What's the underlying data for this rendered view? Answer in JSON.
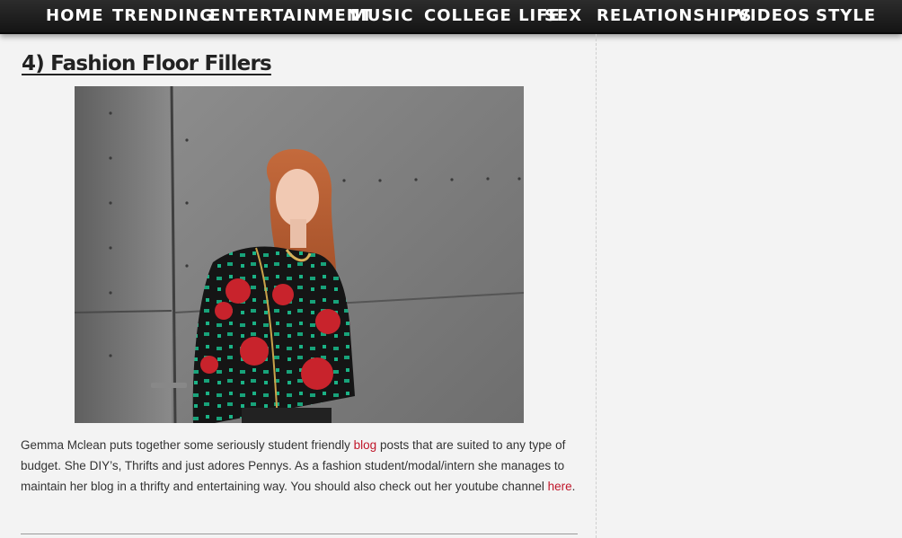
{
  "nav": {
    "items": [
      "HOME",
      "TRENDING",
      "ENTERTAINMENT",
      "MUSIC",
      "COLLEGE LIFE",
      "SEX",
      "RELATIONSHIPS",
      "VIDEOS",
      "STYLE"
    ]
  },
  "post": {
    "title": "4) Fashion Floor Fillers",
    "paragraph": {
      "part1": "Gemma Mclean puts together some seriously student friendly ",
      "link1": "blog",
      "part2": " posts that are suited to any type of budget.  She DIY’s, Thrifts and just adores Pennys. As a fashion student/modal/intern she manages to maintain her blog in a thrifty and entertaining way. You should also check out her youtube channel ",
      "link2": "here",
      "part3": "."
    }
  },
  "colors": {
    "nav_bg": "#1c1c1c",
    "link": "#c0162a",
    "page_bg": "#f3f3f3"
  }
}
